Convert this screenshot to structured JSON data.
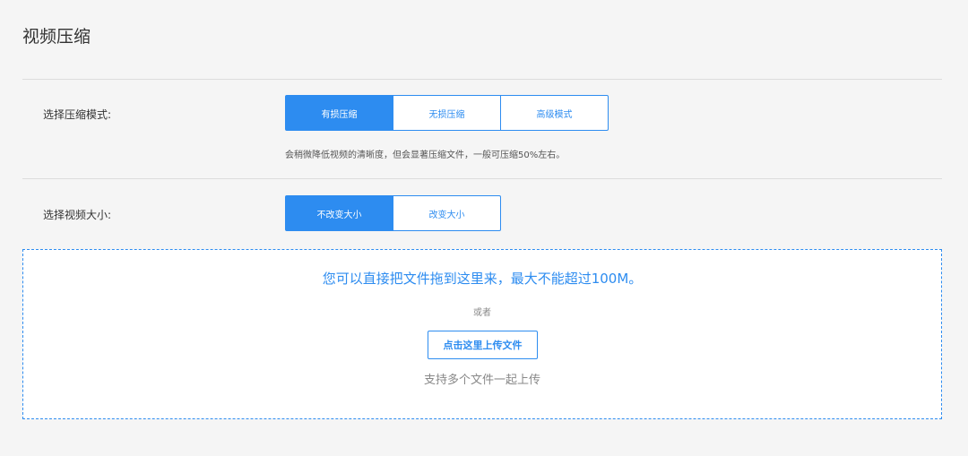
{
  "header": {
    "title": "视频压缩"
  },
  "compress_mode": {
    "label": "选择压缩模式:",
    "options": [
      "有损压缩",
      "无损压缩",
      "高级模式"
    ],
    "selected": "有损压缩",
    "description": "会稍微降低视频的清晰度，但会显著压缩文件，一般可压缩50%左右。"
  },
  "video_size": {
    "label": "选择视频大小:",
    "options": [
      "不改变大小",
      "改变大小"
    ],
    "selected": "不改变大小"
  },
  "upload": {
    "drop_hint": "您可以直接把文件拖到这里来，最大不能超过100M。",
    "or_text": "或者",
    "button_label": "点击这里上传文件",
    "multi_hint": "支持多个文件一起上传"
  },
  "colors": {
    "accent": "#2d8cf0",
    "background": "#f5f5f5"
  }
}
